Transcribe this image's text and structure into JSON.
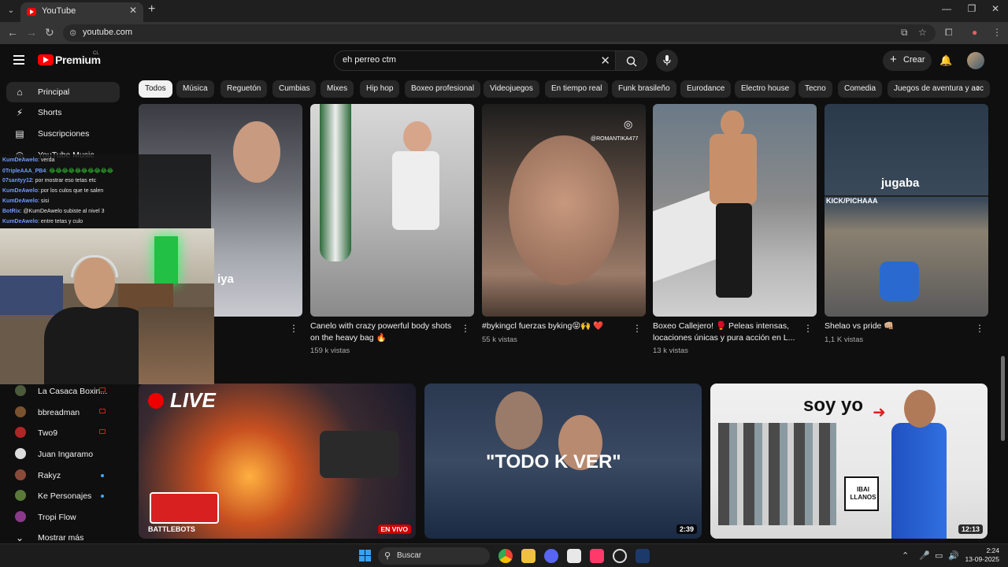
{
  "browser": {
    "tab_title": "YouTube",
    "url": "youtube.com"
  },
  "header": {
    "logo_text": "Premium",
    "logo_country": "CL",
    "search_value": "eh perreo ctm",
    "create_label": "Crear"
  },
  "sidebar": {
    "items": [
      {
        "label": "Principal",
        "icon": "home-icon"
      },
      {
        "label": "Shorts",
        "icon": "shorts-icon"
      },
      {
        "label": "Suscripciones",
        "icon": "subscriptions-icon"
      },
      {
        "label": "YouTube Music",
        "icon": "youtube-music-icon"
      }
    ],
    "subscriptions": [
      {
        "label": "La Casaca Boxin...",
        "status": "live"
      },
      {
        "label": "bbreadman",
        "status": "live"
      },
      {
        "label": "Two9",
        "status": "live"
      },
      {
        "label": "Juan Ingaramo",
        "status": ""
      },
      {
        "label": "Rakyz",
        "status": "new"
      },
      {
        "label": "Ke Personajes",
        "status": "new"
      },
      {
        "label": "Tropi Flow",
        "status": ""
      }
    ],
    "show_more": "Mostrar más"
  },
  "chips": [
    "Todos",
    "Música",
    "Reguetón",
    "Cumbias",
    "Mixes",
    "Hip hop",
    "Boxeo profesional",
    "Videojuegos",
    "En tiempo real",
    "Funk brasileño",
    "Eurodance",
    "Electro house",
    "Tecno",
    "Comedia",
    "Juegos de aventura y acc"
  ],
  "shorts": [
    {
      "title": "",
      "views": "",
      "overlay": "iya"
    },
    {
      "title": "Canelo with crazy powerful body shots on the heavy bag 🔥",
      "views": "159 k vistas",
      "overlay": ""
    },
    {
      "title": "#bykingcl fuerzas byking😝🙌 ❤️",
      "views": "55 k vistas",
      "overlay": "@ROMANTIKA477"
    },
    {
      "title": "Boxeo Callejero! 🥊 Peleas intensas, locaciones únicas y pura acción en L...",
      "views": "13 k vistas",
      "overlay": ""
    },
    {
      "title": "Shelao vs pride 👊🏼",
      "views": "1,1 K vistas",
      "overlay": "jugaba",
      "overlay2": "KICK/PICHAAA"
    }
  ],
  "videos": [
    {
      "badge": "EN VIVO",
      "overlay": "LIVE",
      "overlay2": "BATTLEBOTS"
    },
    {
      "duration": "2:39",
      "overlay": "\"TODO K VER\""
    },
    {
      "duration": "12:13",
      "overlay": "soy yo",
      "sign": "IBAI LLANOS"
    }
  ],
  "chat": [
    {
      "user": "KumDeAwelo",
      "msg": ": verda"
    },
    {
      "user": "0TripleAAA_PB4",
      "msg": ": 😂😂😂😂😂😂😂😂😂😂"
    },
    {
      "user": "07santyy12",
      "msg": ": por mostrar eso tetas etc"
    },
    {
      "user": "KumDeAwelo",
      "msg": ": por los culos que te salen"
    },
    {
      "user": "KumDeAwelo",
      "msg": ": sisi"
    },
    {
      "user": "BotRix",
      "msg": ": @KumDeAwelo subiste al nivel 3"
    },
    {
      "user": "KumDeAwelo",
      "msg": ": entre tetas y culo"
    }
  ],
  "taskbar": {
    "search_label": "Buscar",
    "time": "2:24",
    "date": "13-09-2025"
  },
  "colors": {
    "accent": "#ff0000",
    "background": "#0f0f0f",
    "chip": "#272727"
  }
}
